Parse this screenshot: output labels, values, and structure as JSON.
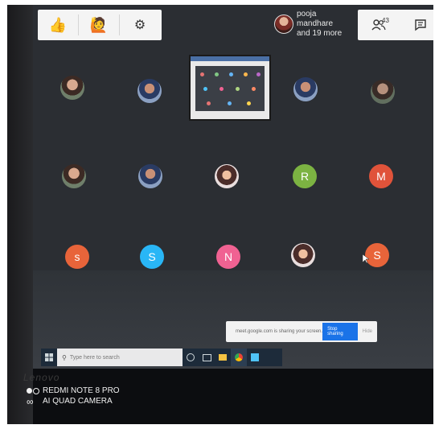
{
  "toolbar_left": {
    "buttons": [
      {
        "name": "thumbs-up-icon",
        "symbol": "👍"
      },
      {
        "name": "raise-hand-icon",
        "symbol": "🙋"
      },
      {
        "name": "gear-icon",
        "symbol": "⚙"
      }
    ]
  },
  "presenter": {
    "line1": "pooja mandhare",
    "line2": "and 19 more"
  },
  "toolbar_right": {
    "participants_count": "43",
    "participants_icon": "people-icon",
    "chat_icon": "chat-icon"
  },
  "participants": [
    {
      "type": "photo",
      "letter": ""
    },
    {
      "type": "photo",
      "letter": ""
    },
    {
      "type": "photo",
      "letter": ""
    },
    {
      "type": "photo",
      "letter": ""
    },
    {
      "type": "photo",
      "letter": ""
    },
    {
      "type": "photo",
      "letter": ""
    },
    {
      "type": "photo",
      "letter": ""
    },
    {
      "type": "letter",
      "letter": "R",
      "color": "#7cb342"
    },
    {
      "type": "letter",
      "letter": "M",
      "color": "#e0533a"
    },
    {
      "type": "letter",
      "letter": "s",
      "color": "#e8643a"
    },
    {
      "type": "letter",
      "letter": "S",
      "color": "#29b6f6"
    },
    {
      "type": "letter",
      "letter": "N",
      "color": "#f06292"
    },
    {
      "type": "photo",
      "letter": ""
    },
    {
      "type": "letter",
      "letter": "S",
      "color": "#e8643a"
    }
  ],
  "share_bar": {
    "text": "meet.google.com is sharing your screen.",
    "stop_label": "Stop sharing",
    "hide_label": "Hide"
  },
  "taskbar": {
    "search_placeholder": "Type here to search"
  },
  "laptop_brand": "Lenovo",
  "watermark": {
    "line1": "REDMI NOTE 8 PRO",
    "line2": "AI QUAD CAMERA"
  },
  "colors": {
    "screen_bg": "#2b2e33",
    "accent_blue": "#1a73e8"
  }
}
